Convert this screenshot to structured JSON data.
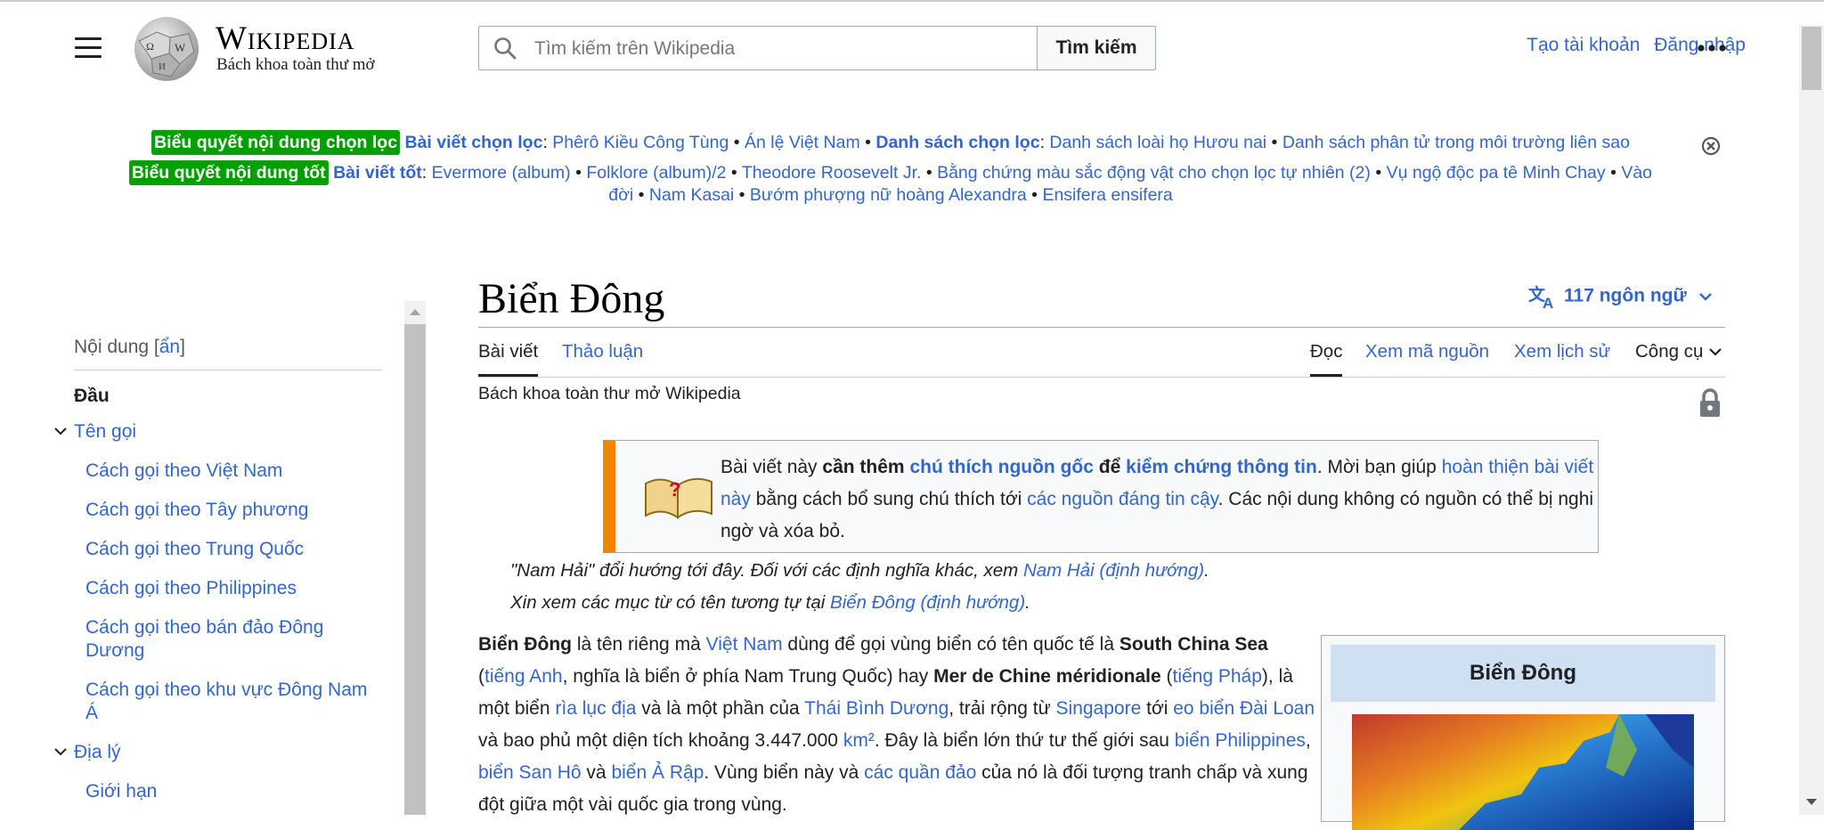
{
  "header": {
    "wordmark": "Wikipedia",
    "tagline": "Bách khoa toàn thư mở",
    "search_placeholder": "Tìm kiếm trên Wikipedia",
    "search_button": "Tìm kiếm",
    "create_account": "Tạo tài khoản",
    "login": "Đăng nhập"
  },
  "notice": {
    "featured_badge": "Biểu quyết nội dung chọn lọc",
    "featured_articles_label": "Bài viết chọn lọc",
    "featured_articles": [
      "Phêrô Kiều Công Tùng",
      "Án lệ Việt Nam"
    ],
    "featured_lists_label": "Danh sách chọn lọc",
    "featured_lists": [
      "Danh sách loài họ Hươu nai",
      "Danh sách phân tử trong môi trường liên sao"
    ],
    "good_badge": "Biểu quyết nội dung tốt",
    "good_articles_label": "Bài viết tốt",
    "good_articles_line1": [
      "Evermore (album)",
      "Folklore (album)/2",
      "Theodore Roosevelt Jr.",
      "Bằng chứng màu sắc động vật cho chọn lọc tự nhiên (2)",
      "Vụ ngộ độc pa tê Minh Chay",
      "Vào"
    ],
    "good_articles_line2": [
      "đời",
      "Nam Kasai",
      "Bướm phượng nữ hoàng Alexandra",
      "Ensifera ensifera"
    ]
  },
  "toc": {
    "title": "Nội dung",
    "toggle": "ẩn",
    "items": [
      {
        "label": "Đầu"
      },
      {
        "label": "Tên gọi"
      },
      {
        "label": "Cách gọi theo Việt Nam"
      },
      {
        "label": "Cách gọi theo Tây phương"
      },
      {
        "label": "Cách gọi theo Trung Quốc"
      },
      {
        "label": "Cách gọi theo Philippines"
      },
      {
        "label": "Cách gọi theo bán đảo Đông Dương"
      },
      {
        "label": "Cách gọi theo khu vực Đông Nam Á"
      },
      {
        "label": "Địa lý"
      },
      {
        "label": "Giới hạn"
      }
    ]
  },
  "article": {
    "title": "Biển Đông",
    "languages": "117 ngôn ngữ",
    "tabs": {
      "article": "Bài viết",
      "talk": "Thảo luận",
      "read": "Đọc",
      "view_source": "Xem mã nguồn",
      "history": "Xem lịch sử",
      "tools": "Công cụ"
    },
    "tagline": "Bách khoa toàn thư mở Wikipedia",
    "ambox": {
      "t1": "Bài viết này ",
      "t2": "cần thêm",
      "t3": "chú thích nguồn gốc",
      "t4": "để",
      "t5": "kiểm chứng thông tin",
      "t6": ". Mời bạn giúp ",
      "t7": "hoàn thiện bài viết này",
      "t8": " bằng cách bổ sung chú thích tới ",
      "t9": "các nguồn đáng tin cậy",
      "t10": ". Các nội dung không có nguồn có thể bị nghi ngờ và xóa bỏ."
    },
    "hatnote1": {
      "text": "\"Nam Hải\" đổi hướng tới đây. Đối với các định nghĩa khác, xem ",
      "link": "Nam Hải (định hướng)",
      "end": "."
    },
    "hatnote2": {
      "text": "Xin xem các mục từ có tên tương tự tại ",
      "link": "Biển Đông (định hướng)",
      "end": "."
    },
    "para": {
      "p1": "Biển Đông",
      "p2": " là tên riêng mà ",
      "p3": "Việt Nam",
      "p4": " dùng để gọi vùng biển có tên quốc tế là ",
      "p5": "South China Sea",
      "p6": " (",
      "p7": "tiếng Anh",
      "p8": ", nghĩa là biển ở phía Nam Trung Quốc) hay ",
      "p9": "Mer de Chine méridionale",
      "p10": " (",
      "p11": "tiếng Pháp",
      "p12": "), là một biển ",
      "p13": "rìa lục địa",
      "p14": " và là một phần của ",
      "p15": "Thái Bình Dương",
      "p16": ", trải rộng từ ",
      "p17": "Singapore",
      "p18": " tới ",
      "p19": "eo biển Đài Loan",
      "p20": " và bao phủ một diện tích khoảng 3.447.000 ",
      "p21": "km²",
      "p22": ". Đây là biển lớn thứ tư thế giới sau ",
      "p23": "biển Philippines",
      "p24": ", ",
      "p25": "biển San Hô",
      "p26": " và ",
      "p27": "biển Ả Rập",
      "p28": ". Vùng biển này và ",
      "p29": "các quần đảo",
      "p30": " của nó là đối tượng tranh chấp và xung đột giữa một vài quốc gia trong vùng."
    },
    "infobox_title": "Biển Đông"
  },
  "colors": {
    "link": "#3366cc",
    "badge": "#00a000",
    "ambox_border": "#f28500",
    "infobox_title_bg": "#cee0f2"
  }
}
